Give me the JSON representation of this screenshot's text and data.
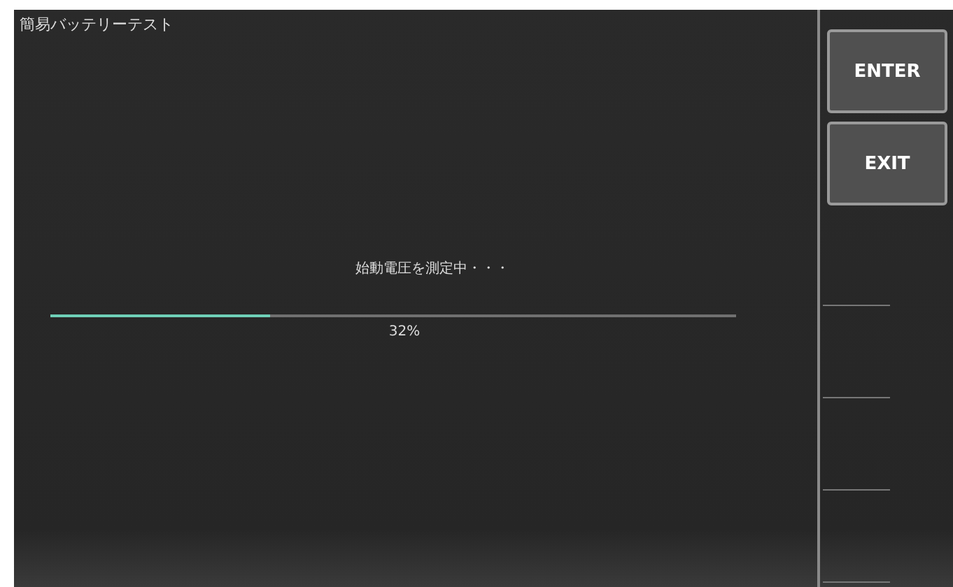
{
  "window": {
    "title": "簡易バッテリーテスト"
  },
  "status": {
    "message": "始動電圧を測定中・・・",
    "level": 0.32,
    "reading": "32%"
  },
  "side_buttons": [
    {
      "label": "ENTER",
      "kind": "button"
    },
    {
      "label": "EXIT",
      "kind": "button"
    },
    {
      "kind": "empty"
    },
    {
      "kind": "empty"
    },
    {
      "kind": "empty"
    },
    {
      "kind": "empty"
    }
  ]
}
